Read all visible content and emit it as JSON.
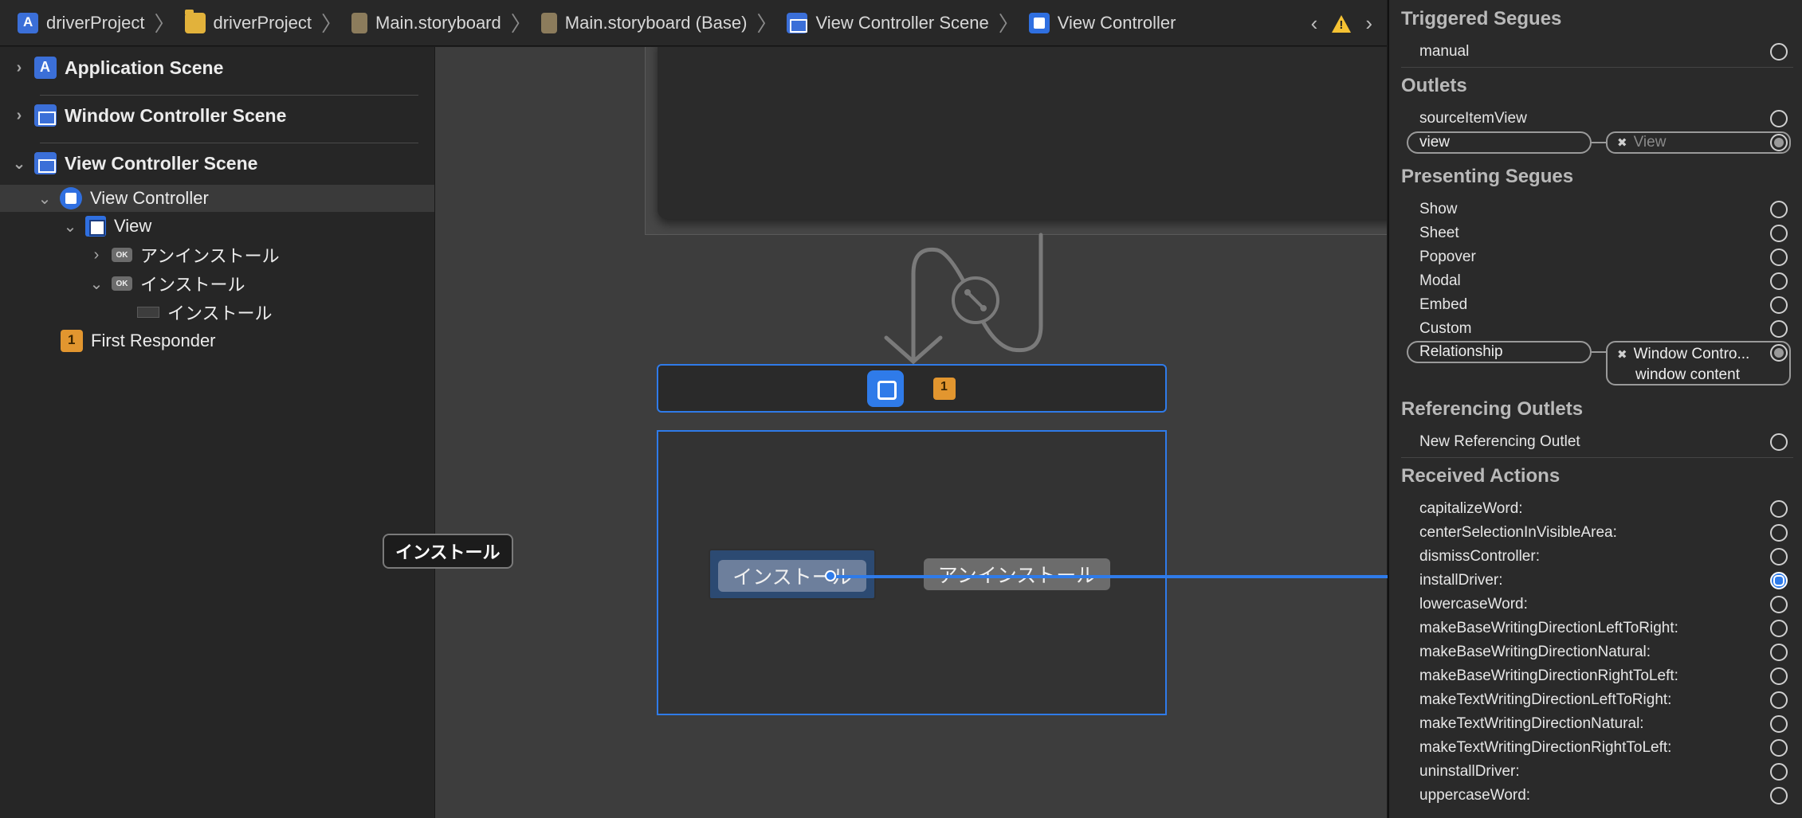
{
  "breadcrumb": [
    {
      "label": "driverProject",
      "icon": "project-icon"
    },
    {
      "label": "driverProject",
      "icon": "folder-icon"
    },
    {
      "label": "Main.storyboard",
      "icon": "storyboard-file-icon"
    },
    {
      "label": "Main.storyboard (Base)",
      "icon": "storyboard-file-icon"
    },
    {
      "label": "View Controller Scene",
      "icon": "scene-icon"
    },
    {
      "label": "View Controller",
      "icon": "view-controller-icon"
    }
  ],
  "outline": {
    "application_scene": "Application Scene",
    "window_controller_scene": "Window Controller Scene",
    "view_controller_scene": "View Controller Scene",
    "view_controller": "View Controller",
    "view": "View",
    "uninstall_button": "アンインストール",
    "install_button": "インストール",
    "install_button_cell": "インストール",
    "first_responder": "First Responder",
    "ok_badge": "OK"
  },
  "canvas": {
    "install_button_label": "インストール",
    "uninstall_button_label": "アンインストール",
    "tooltip": "インストール"
  },
  "inspector": {
    "triggered_segues": {
      "title": "Triggered Segues",
      "items": [
        "manual"
      ]
    },
    "outlets": {
      "title": "Outlets",
      "items": [
        "sourceItemView"
      ],
      "connected_label": "view",
      "connected_target": "View"
    },
    "presenting_segues": {
      "title": "Presenting Segues",
      "items": [
        "Show",
        "Sheet",
        "Popover",
        "Modal",
        "Embed",
        "Custom"
      ],
      "connected_label": "Relationship",
      "connected_target_line1": "Window Contro...",
      "connected_target_line2": "window content"
    },
    "referencing_outlets": {
      "title": "Referencing Outlets",
      "items": [
        "New Referencing Outlet"
      ]
    },
    "received_actions": {
      "title": "Received Actions",
      "items": [
        "capitalizeWord:",
        "centerSelectionInVisibleArea:",
        "dismissController:",
        "installDriver:",
        "lowercaseWord:",
        "makeBaseWritingDirectionLeftToRight:",
        "makeBaseWritingDirectionNatural:",
        "makeBaseWritingDirectionRightToLeft:",
        "makeTextWritingDirectionLeftToRight:",
        "makeTextWritingDirectionNatural:",
        "makeTextWritingDirectionRightToLeft:",
        "uninstallDriver:",
        "uppercaseWord:"
      ]
    }
  },
  "colors": {
    "accent": "#2f7be9",
    "warning": "#f5c233"
  }
}
